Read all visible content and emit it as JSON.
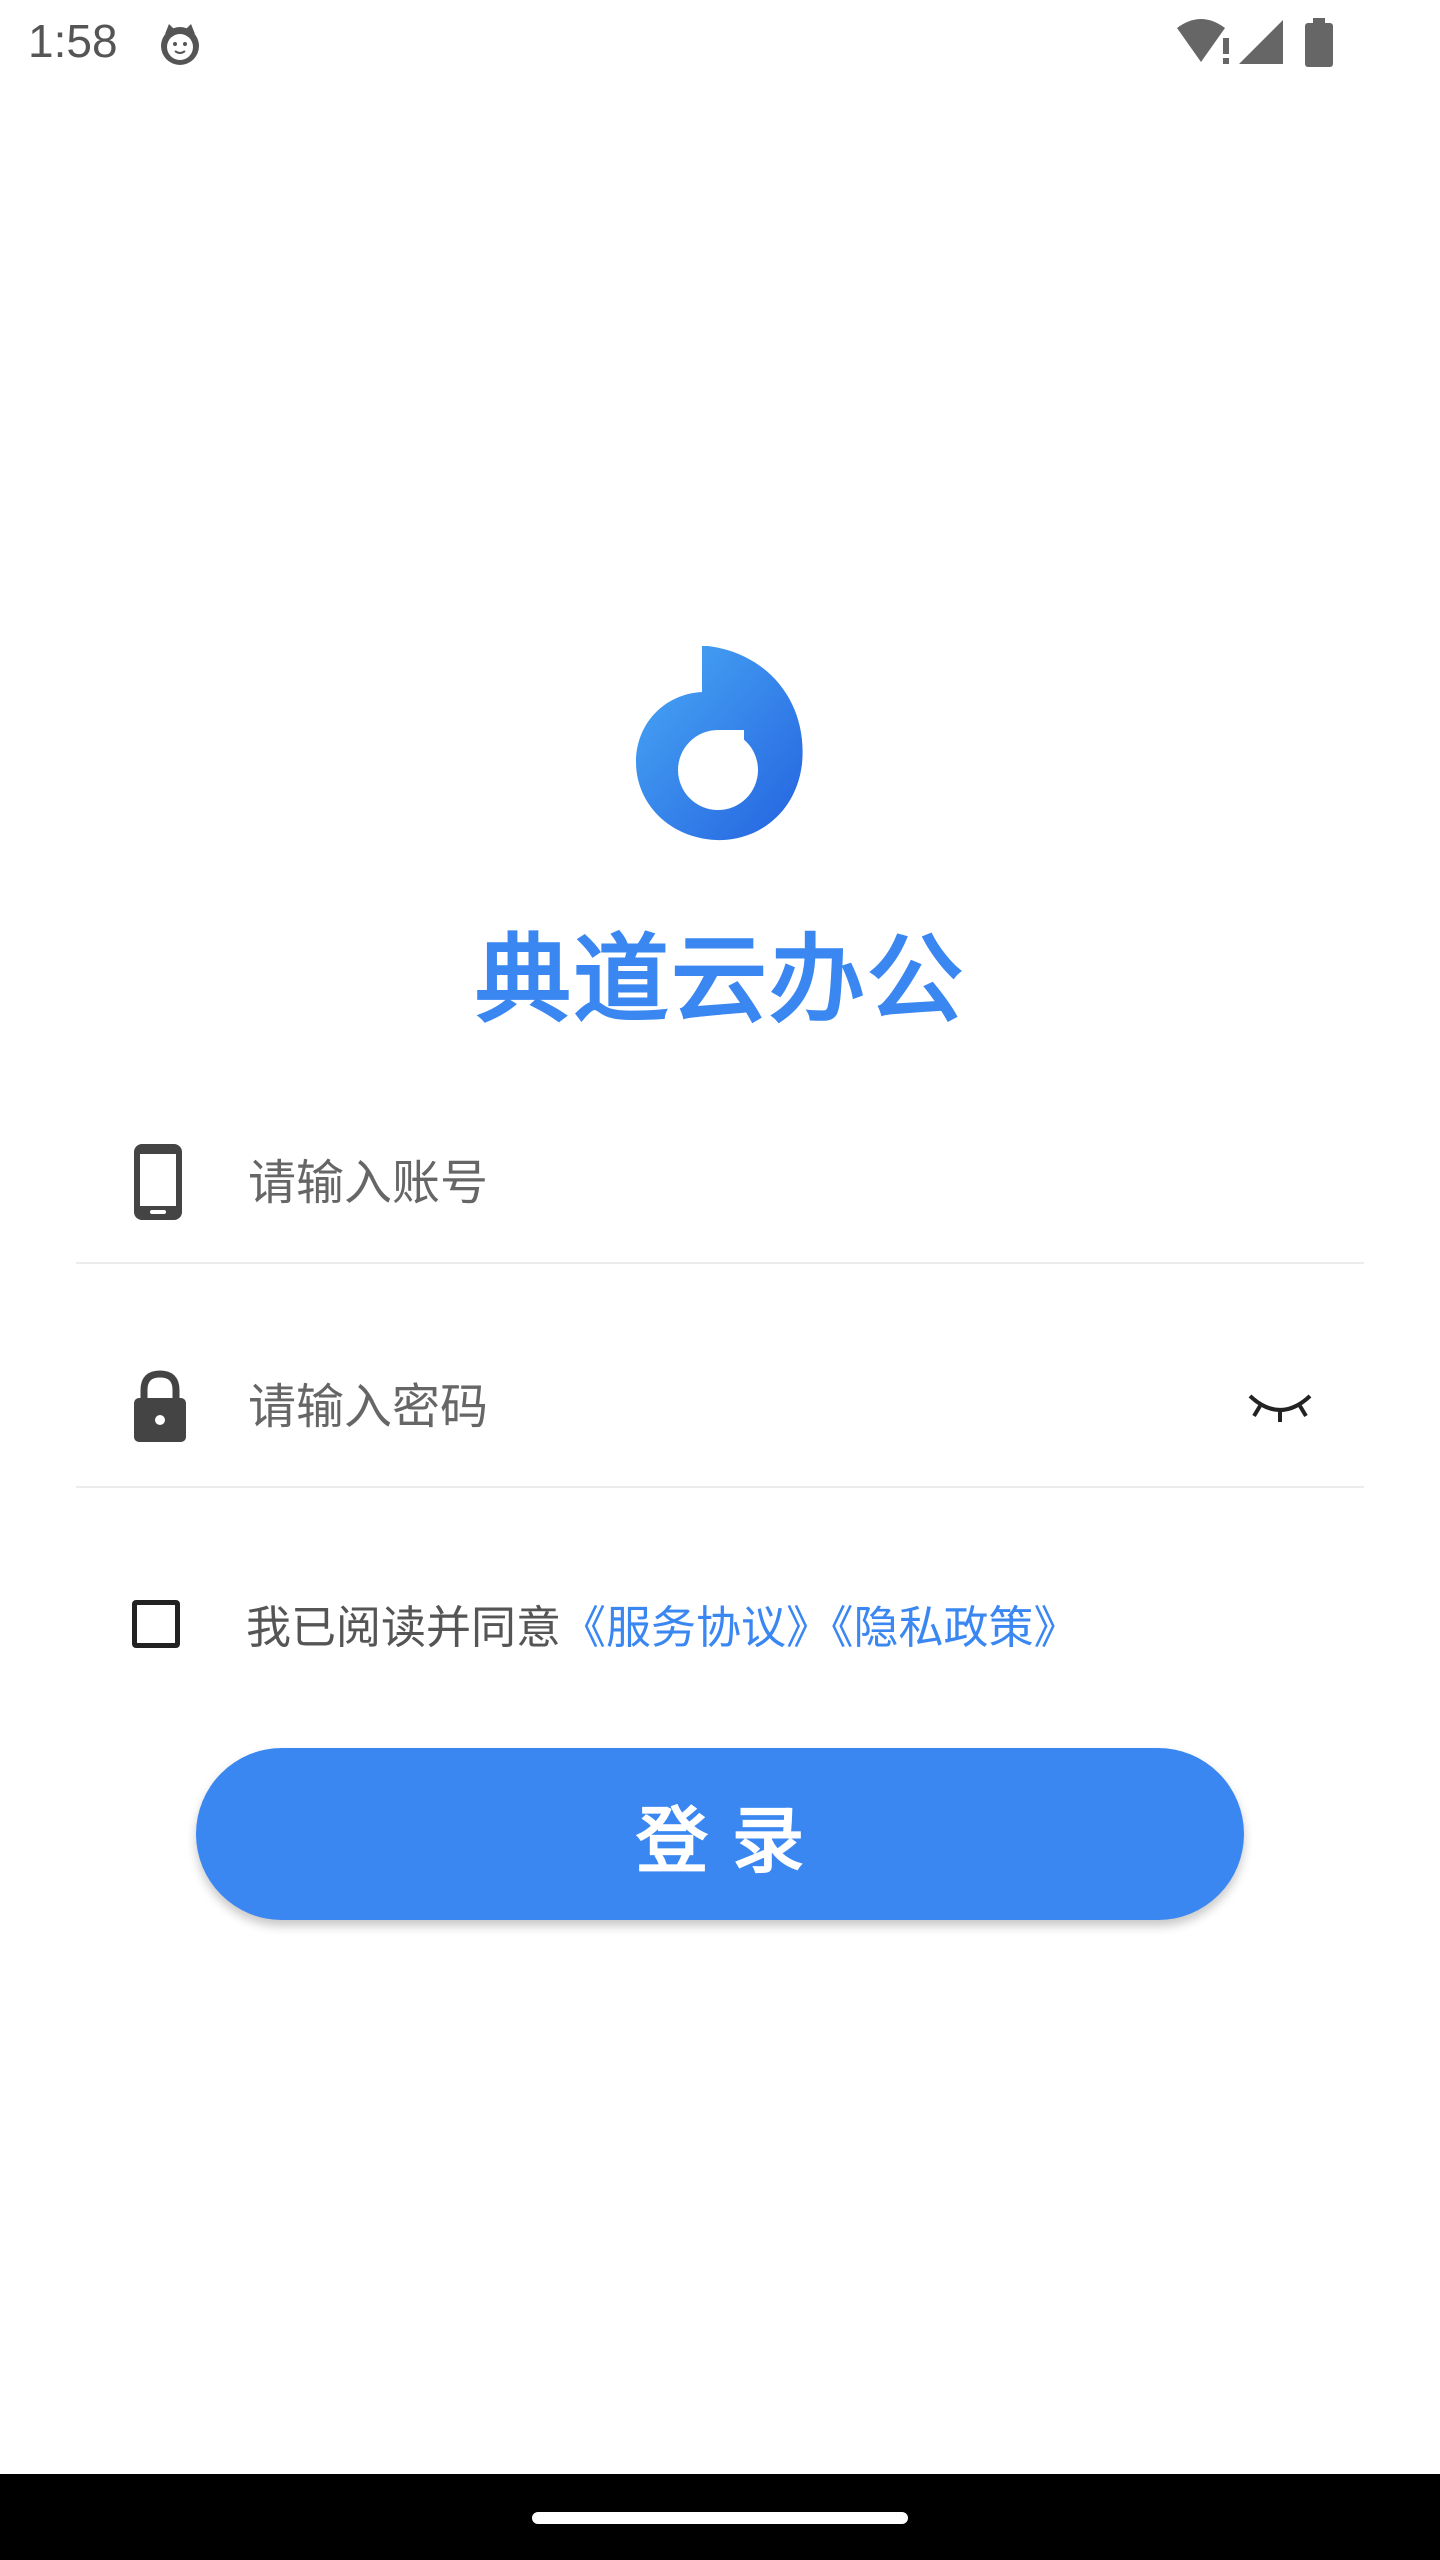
{
  "status_bar": {
    "time": "1:58",
    "notification_icon": "cat-face-icon",
    "icons": [
      "wifi-alert-icon",
      "signal-icon",
      "battery-icon"
    ]
  },
  "app": {
    "logo_icon": "app-logo-icon",
    "title": "典道云办公",
    "accent_color": "#3a87f2"
  },
  "form": {
    "account": {
      "icon": "phone-icon",
      "placeholder": "请输入账号",
      "value": ""
    },
    "password": {
      "icon": "lock-icon",
      "placeholder": "请输入密码",
      "value": "",
      "toggle_icon": "eye-closed-icon"
    },
    "agreement": {
      "checked": false,
      "prefix": "我已阅读并同意",
      "service_link": "《服务协议》",
      "privacy_link": "《隐私政策》"
    },
    "login_label": "登录"
  }
}
